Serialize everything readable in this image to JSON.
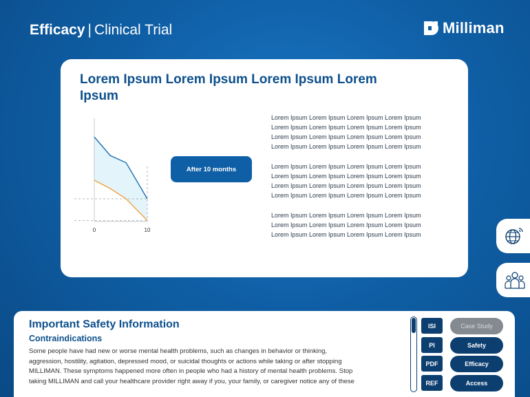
{
  "header": {
    "title_bold": "Efficacy",
    "separator": "|",
    "title_rest": "Clinical Trial"
  },
  "logo": {
    "name": "Milliman"
  },
  "card": {
    "title": "Lorem Ipsum Lorem Ipsum Lorem Ipsum Lorem Ipsum",
    "period_button": "After 10 months",
    "paragraphs": [
      [
        "Lorem Ipsum Lorem Ipsum Lorem Ipsum Lorem Ipsum",
        "Lorem Ipsum Lorem Ipsum Lorem Ipsum Lorem Ipsum",
        "Lorem Ipsum Lorem Ipsum Lorem Ipsum Lorem Ipsum",
        "Lorem Ipsum Lorem Ipsum Lorem Ipsum Lorem Ipsum"
      ],
      [
        "Lorem Ipsum Lorem Ipsum Lorem Ipsum Lorem Ipsum",
        "Lorem Ipsum Lorem Ipsum Lorem Ipsum Lorem Ipsum",
        "Lorem Ipsum Lorem Ipsum Lorem Ipsum Lorem Ipsum",
        "Lorem Ipsum Lorem Ipsum Lorem Ipsum Lorem Ipsum"
      ],
      [
        "Lorem Ipsum Lorem Ipsum Lorem Ipsum Lorem Ipsum",
        "Lorem Ipsum Lorem Ipsum Lorem Ipsum Lorem Ipsum",
        "Lorem Ipsum Lorem Ipsum Lorem Ipsum Lorem Ipsum"
      ]
    ]
  },
  "chart_data": {
    "type": "line",
    "x_ticks": [
      "0",
      "10"
    ],
    "xlim": [
      0,
      10
    ],
    "ylim": [
      0,
      100
    ],
    "series": [
      {
        "color": "#1f6fb2",
        "x": [
          0,
          3,
          6,
          10
        ],
        "y": [
          82,
          64,
          57,
          22
        ]
      },
      {
        "color": "#f0a23a",
        "x": [
          0,
          3,
          6,
          10
        ],
        "y": [
          40,
          32,
          22,
          1
        ]
      }
    ],
    "fill_between": {
      "color": "#e3f4fa"
    },
    "dashed_reference_y": [
      22,
      1
    ],
    "dashed_reference_x": [
      10
    ]
  },
  "side_icons": [
    {
      "icon": "globe-icon",
      "name": "globe-button"
    },
    {
      "icon": "people-icon",
      "name": "people-button"
    }
  ],
  "isi": {
    "title": "Important Safety Information",
    "subtitle": "Contraindications",
    "lines": [
      "Some people have had new or worse mental health problems, such as changes in behavior or thinking,",
      "aggression, hostility, agitation, depressed mood, or suicidal thoughts or actions while taking or after stopping",
      "MILLIMAN. These symptoms happened more often in people who had a history of mental health problems. Stop",
      "taking MILLIMAN and call your healthcare provider right away if you, your family, or caregiver notice any of these"
    ]
  },
  "nav": {
    "squares": [
      "ISI",
      "PI",
      "PDF",
      "REF"
    ],
    "pills": [
      "Case Study",
      "Safety",
      "Efficacy",
      "Access"
    ],
    "disabled_pill": "Case Study"
  }
}
